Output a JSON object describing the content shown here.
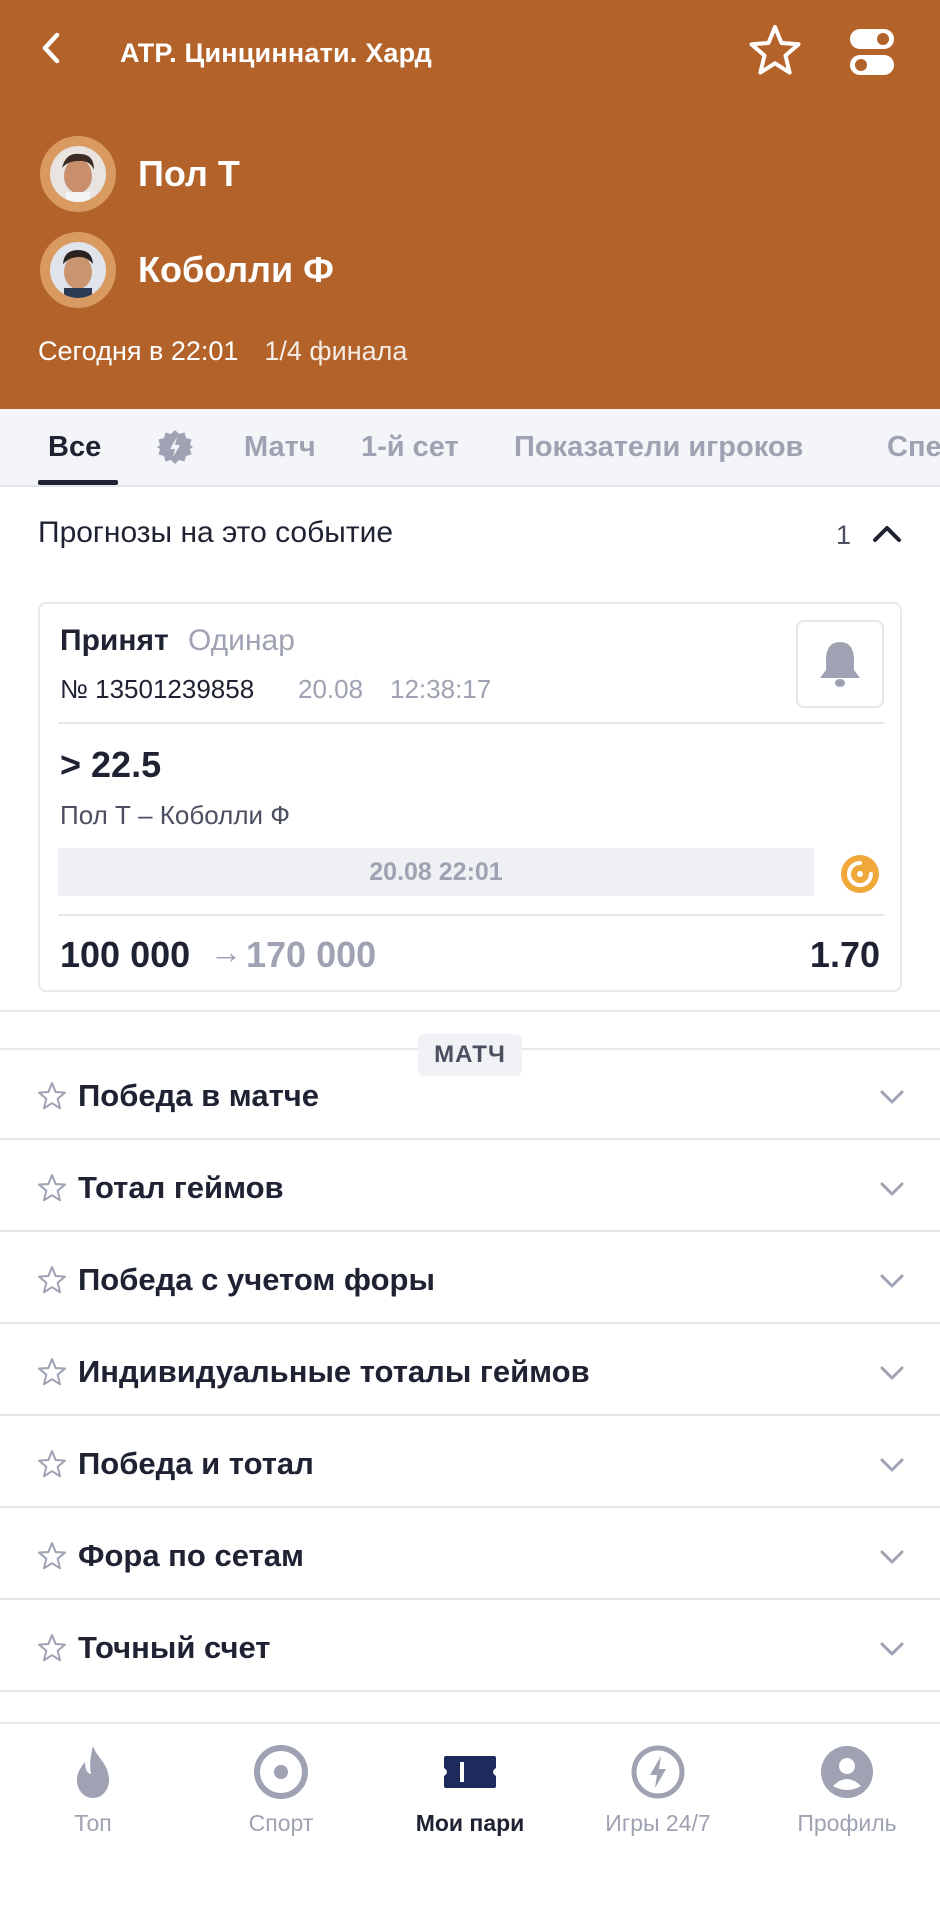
{
  "header": {
    "title": "ATP. Цинциннати. Хард",
    "players": [
      {
        "name": "Пол Т"
      },
      {
        "name": "Коболли Ф"
      }
    ],
    "start_time": "Сегодня в 22:01",
    "round": "1/4 финала",
    "background_color": "#b3632a"
  },
  "tabs": [
    {
      "label": "Все",
      "active": true
    },
    {
      "label": "gear-icon",
      "icon": true
    },
    {
      "label": "Матч"
    },
    {
      "label": "1-й сет"
    },
    {
      "label": "Показатели игроков"
    },
    {
      "label": "Спе"
    }
  ],
  "forecasts": {
    "title": "Прогнозы на это событие",
    "count": "1"
  },
  "bet": {
    "status": "Принят",
    "type": "Одинар",
    "number": "№ 13501239858",
    "date": "20.08",
    "time": "12:38:17",
    "outcome": "> 22.5",
    "event": "Пол Т – Коболли Ф",
    "event_time": "20.08 22:01",
    "stake": "100 000",
    "arrow": "→",
    "potential_win": "170 000",
    "odds": "1.70"
  },
  "section_label": "МАТЧ",
  "markets": [
    {
      "label": "Победа в матче"
    },
    {
      "label": "Тотал геймов"
    },
    {
      "label": "Победа с учетом форы"
    },
    {
      "label": "Индивидуальные тоталы геймов"
    },
    {
      "label": "Победа и тотал"
    },
    {
      "label": "Фора по сетам"
    },
    {
      "label": "Точный счет"
    }
  ],
  "bottom_nav": [
    {
      "label": "Топ",
      "icon": "flame-icon"
    },
    {
      "label": "Спорт",
      "icon": "sport-target-icon"
    },
    {
      "label": "Мои пари",
      "icon": "ticket-icon",
      "active": true
    },
    {
      "label": "Игры 24/7",
      "icon": "lightning-icon"
    },
    {
      "label": "Профиль",
      "icon": "profile-icon"
    }
  ],
  "colors": {
    "accent_orange": "#b3632a",
    "dark_text": "#1f2233",
    "muted_text": "#9ea2b2",
    "live_icon": "#f0a83a"
  }
}
